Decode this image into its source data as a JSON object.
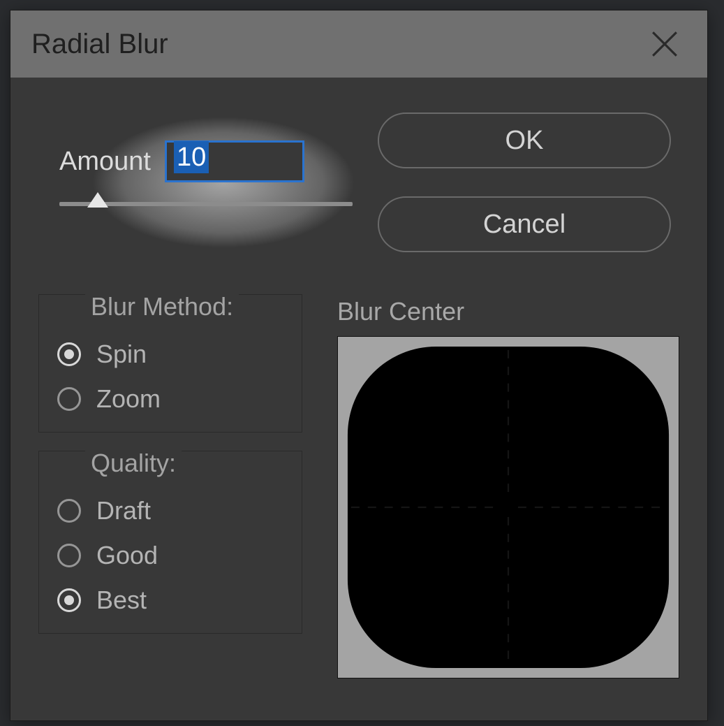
{
  "dialog": {
    "title": "Radial Blur",
    "amount_label": "Amount",
    "amount_value": "10",
    "ok": "OK",
    "cancel": "Cancel",
    "blur_method_label": "Blur Method:",
    "blur_method": {
      "spin": "Spin",
      "zoom": "Zoom",
      "selected": "spin"
    },
    "quality_label": "Quality:",
    "quality": {
      "draft": "Draft",
      "good": "Good",
      "best": "Best",
      "selected": "best"
    },
    "blur_center_label": "Blur Center"
  }
}
